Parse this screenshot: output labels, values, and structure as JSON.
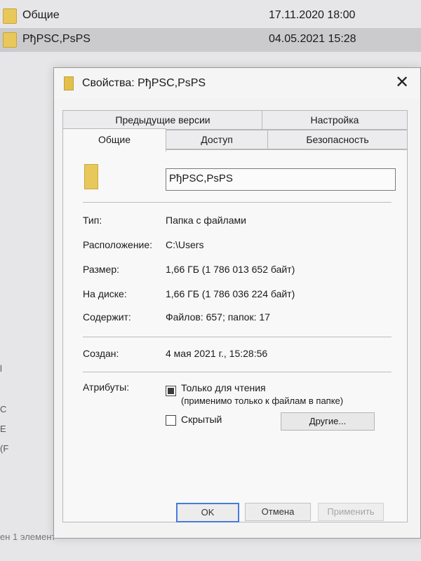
{
  "explorer": {
    "rows": [
      {
        "name": "Общие",
        "date": "17.11.2020 18:00"
      },
      {
        "name": "РђPSC,PsPS",
        "date": "04.05.2021 15:28"
      }
    ],
    "side_fragments": [
      "l",
      "C",
      "E",
      "(F"
    ],
    "status": "ен 1 элемент"
  },
  "dialog": {
    "title": "Свойства: РђPSC,PsPS",
    "close_glyph": "✕",
    "tabs": {
      "previous_versions": "Предыдущие версии",
      "settings": "Настройка",
      "general": "Общие",
      "access": "Доступ",
      "security": "Безопасность"
    },
    "name_value": "РђPSC,PsPS",
    "props": [
      {
        "label": "Тип:",
        "value": "Папка с файлами"
      },
      {
        "label": "Расположение:",
        "value": "C:\\Users"
      },
      {
        "label": "Размер:",
        "value": "1,66 ГБ (1 786 013 652 байт)"
      },
      {
        "label": "На диске:",
        "value": "1,66 ГБ (1 786 036 224 байт)"
      },
      {
        "label": "Содержит:",
        "value": "Файлов: 657; папок: 17"
      }
    ],
    "created": {
      "label": "Создан:",
      "value": "4 мая 2021 г., 15:28:56"
    },
    "attributes": {
      "label": "Атрибуты:",
      "readonly_label": "Только для чтения",
      "readonly_note": "(применимо только к файлам в папке)",
      "readonly_checked": "indeterminate",
      "hidden_label": "Скрытый",
      "hidden_checked": false,
      "other_button": "Другие..."
    },
    "buttons": {
      "ok": "OK",
      "cancel": "Отмена",
      "apply": "Применить"
    }
  },
  "colors": {
    "folder": "#e8c85a",
    "ok_border": "#4a7ad9"
  }
}
